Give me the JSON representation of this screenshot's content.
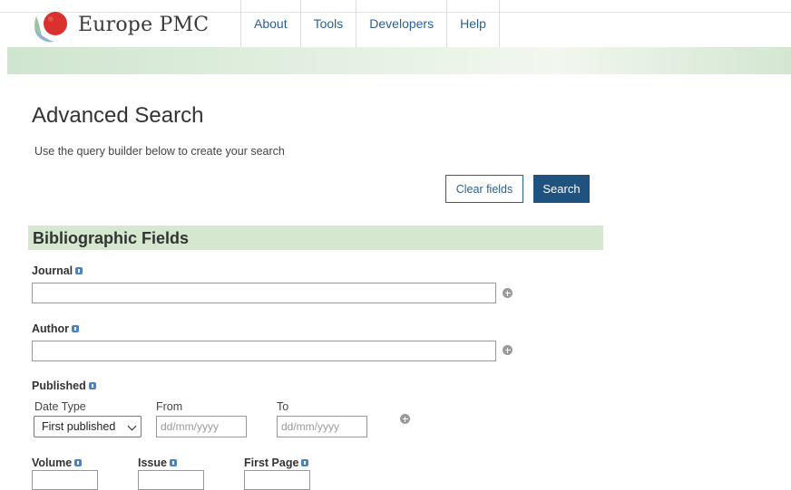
{
  "header": {
    "brand": "Europe PMC",
    "nav": [
      "About",
      "Tools",
      "Developers",
      "Help"
    ]
  },
  "page": {
    "title": "Advanced Search",
    "subtitle": "Use the query builder below to create your search",
    "clear_label": "Clear fields",
    "search_label": "Search"
  },
  "section": {
    "title": "Bibliographic Fields"
  },
  "fields": {
    "journal": "Journal",
    "author": "Author",
    "published": "Published",
    "date_type_label": "Date Type",
    "date_type_value": "First published",
    "from_label": "From",
    "to_label": "To",
    "from_placeholder": "dd/mm/yyyy",
    "to_placeholder": "dd/mm/yyyy",
    "volume": "Volume",
    "issue": "Issue",
    "first_page": "First Page"
  },
  "colors": {
    "link": "#2b5f8f",
    "primary_button": "#20527f",
    "section_bg": "#d5e8cf"
  }
}
